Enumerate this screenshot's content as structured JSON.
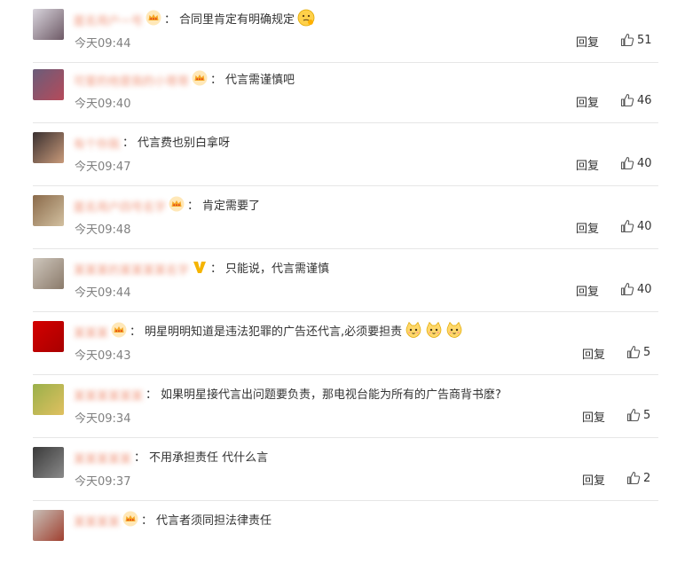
{
  "reply_label": "回复",
  "comments": [
    {
      "username": "匿名用户一号",
      "badge": "crown",
      "text": "合同里肯定有明确规定",
      "emoji": [
        "thinking-emoji"
      ],
      "time": "今天09:44",
      "likes": "51",
      "avatar_colors": [
        "#d8d4dc",
        "#6e5a66"
      ]
    },
    {
      "username": "可爱的他是我的小哥哥",
      "badge": "crown",
      "text": "代言需谨慎吧",
      "emoji": [],
      "time": "今天09:40",
      "likes": "46",
      "avatar_colors": [
        "#6a5d7a",
        "#b64a5a"
      ]
    },
    {
      "username": "有个你我",
      "badge": "none",
      "text": "代言费也别白拿呀",
      "emoji": [],
      "time": "今天09:47",
      "likes": "40",
      "avatar_colors": [
        "#3a3030",
        "#c89a7a"
      ]
    },
    {
      "username": "匿名用户四号名字",
      "badge": "crown",
      "text": "肯定需要了",
      "emoji": [],
      "time": "今天09:48",
      "likes": "40",
      "avatar_colors": [
        "#8a6a4a",
        "#d2c0a0"
      ]
    },
    {
      "username": "某某某的某某某某名字",
      "badge": "v",
      "text": "只能说，代言需谨慎",
      "emoji": [],
      "time": "今天09:44",
      "likes": "40",
      "avatar_colors": [
        "#cfc7bd",
        "#8a7a6a"
      ]
    },
    {
      "username": "某某某",
      "badge": "crown",
      "text": "明星明明知道是违法犯罪的广告还代言,必须要担责",
      "emoji": [
        "cat-emoji",
        "cat-emoji",
        "cat-emoji"
      ],
      "time": "今天09:43",
      "likes": "5",
      "avatar_colors": [
        "#d40000",
        "#a80000"
      ]
    },
    {
      "username": "某某某某某某",
      "badge": "none",
      "text": "如果明星接代言出问题要负责，那电视台能为所有的广告商背书麽?",
      "emoji": [],
      "time": "今天09:34",
      "likes": "5",
      "avatar_colors": [
        "#9ab04a",
        "#e0c060"
      ]
    },
    {
      "username": "某某某某某",
      "badge": "none",
      "text": "不用承担责任 代什么言",
      "emoji": [],
      "time": "今天09:37",
      "likes": "2",
      "avatar_colors": [
        "#3a3a3a",
        "#8a8a8a"
      ]
    },
    {
      "username": "某某某某",
      "badge": "crown",
      "text": "代言者须同担法律责任",
      "emoji": [],
      "time": "",
      "likes": "",
      "avatar_colors": [
        "#c8c0b8",
        "#a04030"
      ]
    }
  ]
}
